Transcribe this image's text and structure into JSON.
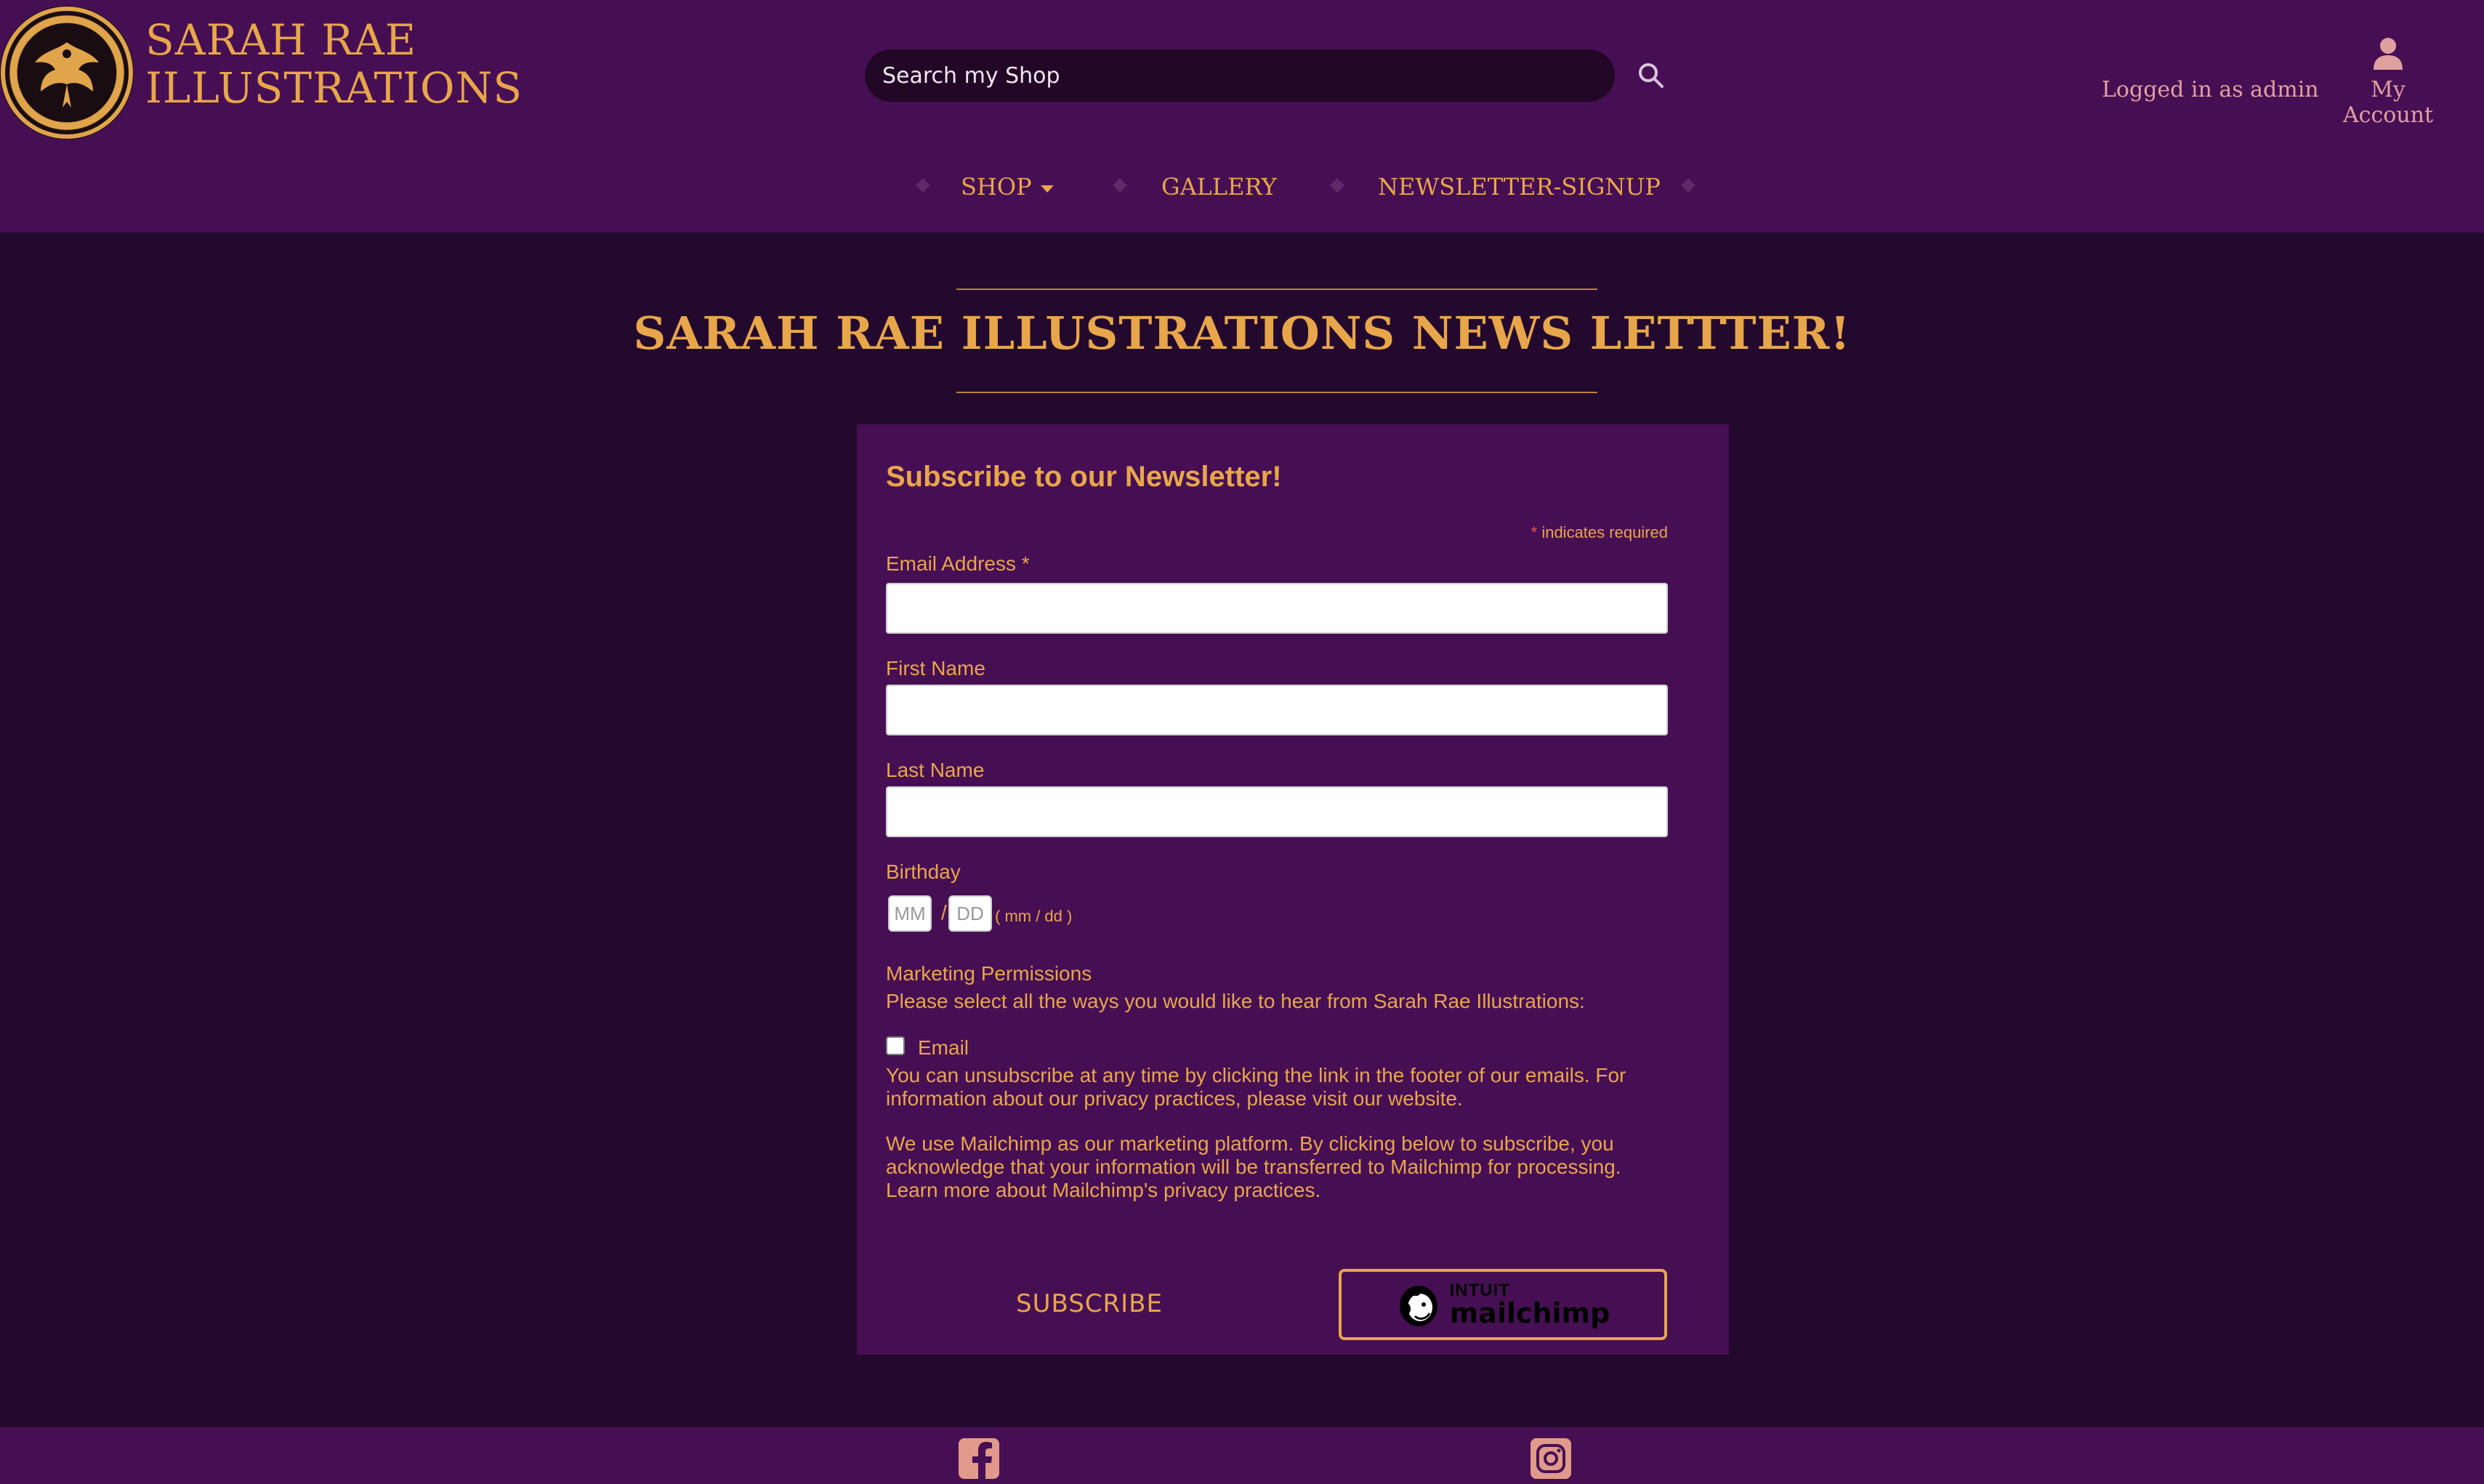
{
  "brand": {
    "line1": "SARAH RAE",
    "line2": "ILLUSTRATIONS",
    "logo_icon": "sarah-rae-seal-logo"
  },
  "search": {
    "placeholder": "Search my Shop",
    "icon": "search-icon"
  },
  "account": {
    "logged_in_text": "Logged in as admin",
    "my_account_label": "My Account",
    "icon": "user-icon"
  },
  "nav": {
    "items": [
      {
        "label": "SHOP",
        "has_dropdown": true
      },
      {
        "label": "GALLERY",
        "has_dropdown": false
      },
      {
        "label": "NEWSLETTER-SIGNUP",
        "has_dropdown": false
      }
    ]
  },
  "page": {
    "title": "SARAH RAE ILLUSTRATIONS NEWS LETTTER!"
  },
  "form": {
    "heading": "Subscribe to our Newsletter!",
    "required_star": "*",
    "required_note": "indicates required",
    "email_label": "Email Address",
    "first_name_label": "First Name",
    "last_name_label": "Last Name",
    "birthday_label": "Birthday",
    "birthday_month_placeholder": "MM",
    "birthday_day_placeholder": "DD",
    "birthday_separator": "/",
    "birthday_hint": "( mm / dd )",
    "marketing_heading": "Marketing Permissions",
    "marketing_prompt": "Please select all the ways you would like to hear from Sarah Rae Illustrations:",
    "email_option_label": "Email",
    "email_option_checked": false,
    "unsubscribe_text": "You can unsubscribe at any time by clicking the link in the footer of our emails. For information about our privacy practices, please visit our website.",
    "mailchimp_text": "We use Mailchimp as our marketing platform. By clicking below to subscribe, you acknowledge that your information will be transferred to Mailchimp for processing.",
    "learn_more_text": "Learn more about Mailchimp's privacy practices.",
    "subscribe_label": "SUBSCRIBE",
    "badge_intuit": "INTUIT",
    "badge_mailchimp": "mailchimp"
  },
  "footer": {
    "icons": [
      "facebook-icon",
      "instagram-icon"
    ]
  },
  "colors": {
    "accent": "#e8a64a",
    "header_bg": "#460f54",
    "page_bg": "#24092e",
    "search_bg": "#220726",
    "account_text": "#e0a0a0"
  }
}
